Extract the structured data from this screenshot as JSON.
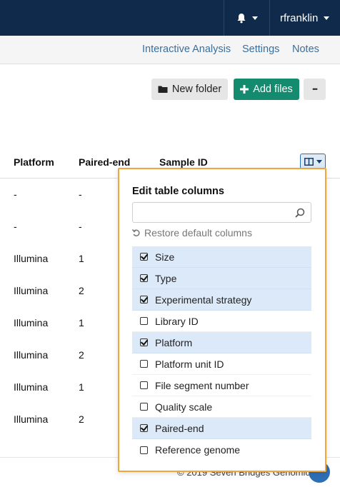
{
  "header": {
    "username": "rfranklin"
  },
  "subnav": {
    "links": [
      "Interactive Analysis",
      "Settings",
      "Notes"
    ]
  },
  "toolbar": {
    "new_folder_label": "New folder",
    "add_files_label": "Add files",
    "more_label": "•••"
  },
  "table": {
    "headers": [
      "Platform",
      "Paired-end",
      "Sample ID"
    ],
    "rows": [
      [
        "-",
        "-"
      ],
      [
        "-",
        "-"
      ],
      [
        "Illumina",
        "1"
      ],
      [
        "Illumina",
        "2"
      ],
      [
        "Illumina",
        "1"
      ],
      [
        "Illumina",
        "2"
      ],
      [
        "Illumina",
        "1"
      ],
      [
        "Illumina",
        "2"
      ]
    ]
  },
  "footer": {
    "copyright": "© 2019 Seven Bridges Genomics"
  },
  "columns_popover": {
    "title": "Edit table columns",
    "search_value": "",
    "restore_label": "Restore default columns",
    "options": [
      {
        "label": "Size",
        "checked": true
      },
      {
        "label": "Type",
        "checked": true
      },
      {
        "label": "Experimental strategy",
        "checked": true
      },
      {
        "label": "Library ID",
        "checked": false
      },
      {
        "label": "Platform",
        "checked": true
      },
      {
        "label": "Platform unit ID",
        "checked": false
      },
      {
        "label": "File segment number",
        "checked": false
      },
      {
        "label": "Quality scale",
        "checked": false
      },
      {
        "label": "Paired-end",
        "checked": true
      },
      {
        "label": "Reference genome",
        "checked": false
      }
    ]
  },
  "colors": {
    "topbar": "#0f2a4a",
    "accent_green": "#148a6e",
    "popover_border": "#f1a63a",
    "selected_row": "#dbe9f8",
    "link": "#3b6f9a"
  }
}
